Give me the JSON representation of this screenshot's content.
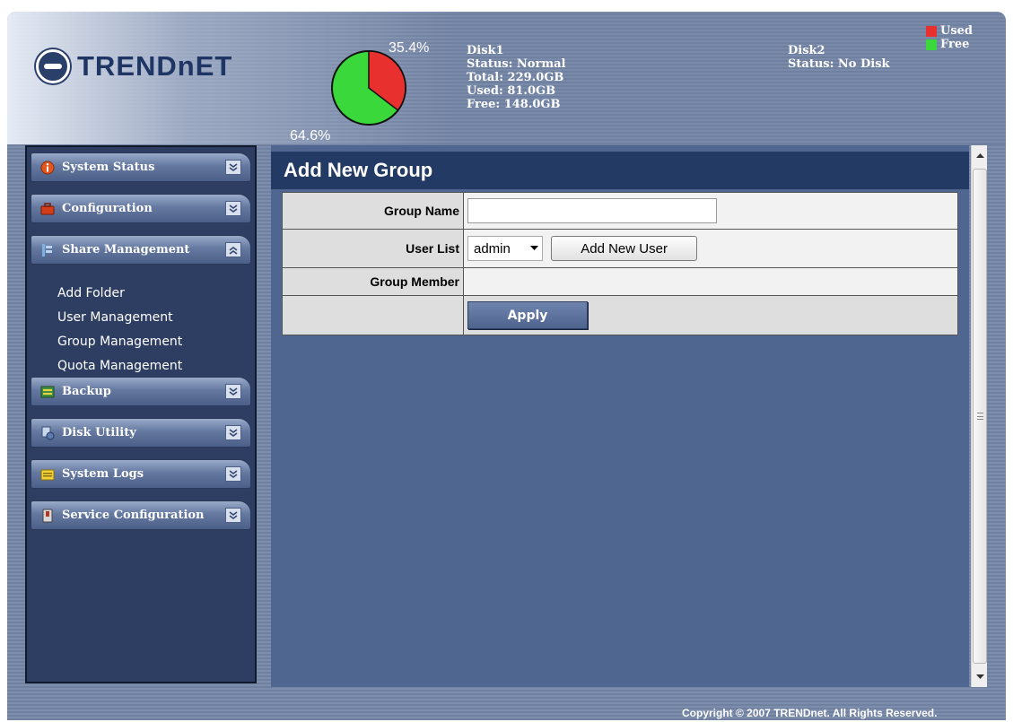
{
  "brand": {
    "logo_text": "TRENDnET"
  },
  "disk_usage": {
    "used_pct_label": "35.4%",
    "free_pct_label": "64.6%",
    "used_fraction": 0.354,
    "used_color": "#e8302e",
    "free_color": "#3ad83a"
  },
  "disk1": {
    "name": "Disk1",
    "status": "Status: Normal",
    "total": "Total: 229.0GB",
    "used": "Used: 81.0GB",
    "free": "Free: 148.0GB"
  },
  "disk2": {
    "name": "Disk2",
    "status": "Status: No Disk"
  },
  "legend": {
    "used": "Used",
    "free": "Free"
  },
  "sidebar": {
    "items": [
      {
        "label": "System Status",
        "icon": "info-icon",
        "expanded": false
      },
      {
        "label": "Configuration",
        "icon": "toolbox-icon",
        "expanded": false
      },
      {
        "label": "Share Management",
        "icon": "share-icon",
        "expanded": true
      },
      {
        "label": "Backup",
        "icon": "backup-icon",
        "expanded": false
      },
      {
        "label": "Disk Utility",
        "icon": "disk-icon",
        "expanded": false
      },
      {
        "label": "System Logs",
        "icon": "logs-icon",
        "expanded": false
      },
      {
        "label": "Service Configuration",
        "icon": "service-icon",
        "expanded": false
      }
    ],
    "submenu": [
      "Add Folder",
      "User Management",
      "Group Management",
      "Quota Management"
    ]
  },
  "main": {
    "title": "Add New Group",
    "form": {
      "group_name_label": "Group Name",
      "group_name_value": "",
      "user_list_label": "User List",
      "user_list_selected": "admin",
      "add_user_button": "Add New User",
      "group_member_label": "Group Member",
      "apply_button": "Apply"
    }
  },
  "footer": {
    "copyright": "Copyright © 2007 TRENDnet. All Rights Reserved."
  }
}
